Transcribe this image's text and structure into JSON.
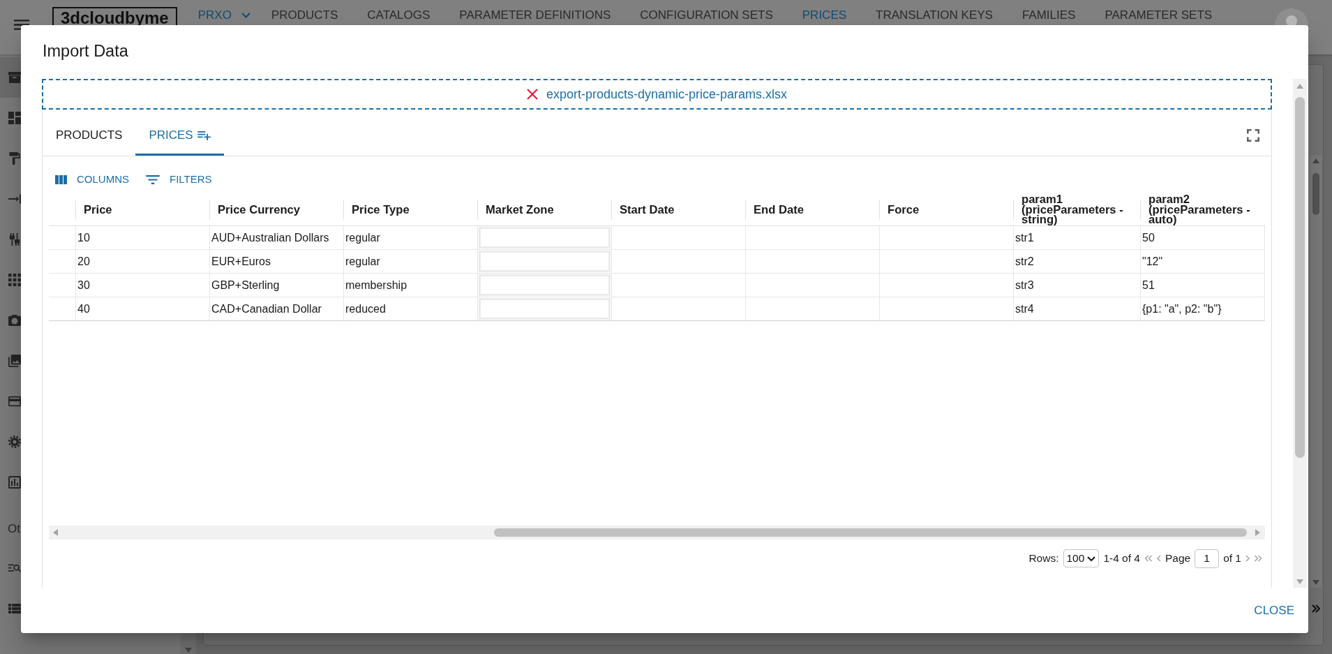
{
  "app": {
    "logo": "3dcloudbyme",
    "workspace": "PRXO",
    "nav": [
      {
        "label": "PRODUCTS",
        "selected": false
      },
      {
        "label": "CATALOGS",
        "selected": false
      },
      {
        "label": "PARAMETER DEFINITIONS",
        "selected": false
      },
      {
        "label": "CONFIGURATION SETS",
        "selected": false
      },
      {
        "label": "PRICES",
        "selected": true
      },
      {
        "label": "TRANSLATION KEYS",
        "selected": false
      },
      {
        "label": "FAMILIES",
        "selected": false
      },
      {
        "label": "PARAMETER SETS",
        "selected": false
      }
    ]
  },
  "sidebar": {
    "items": [
      {
        "selected": true
      },
      {
        "selected": false
      },
      {
        "selected": false
      },
      {
        "selected": false
      },
      {
        "selected": false
      },
      {
        "selected": false
      },
      {
        "selected": false
      },
      {
        "selected": false
      },
      {
        "selected": false
      },
      {
        "selected": false
      },
      {
        "selected": false
      }
    ],
    "sections": [
      {
        "title": "Ot",
        "items": [
          {
            "selected": false
          },
          {
            "selected": false
          }
        ]
      }
    ]
  },
  "dialog": {
    "title": "Import Data",
    "file": {
      "name": "export-products-dynamic-price-params.xlsx"
    },
    "tabs": [
      {
        "label": "PRODUCTS",
        "selected": false,
        "has_icon": false
      },
      {
        "label": "PRICES",
        "selected": true,
        "has_icon": true
      }
    ],
    "toolbar": [
      {
        "kind": "columns",
        "label": "COLUMNS"
      },
      {
        "kind": "filters",
        "label": "FILTERS"
      }
    ],
    "table": {
      "columns": [
        "Price",
        "Price Currency",
        "Price Type",
        "Market Zone",
        "Start Date",
        "End Date",
        "Force",
        "param1 (priceParameters - string)",
        "param2 (priceParameters - auto)"
      ],
      "rows": [
        {
          "cells": [
            {
              "kind": "text",
              "text": "10"
            },
            {
              "kind": "text",
              "text": "AUD+Australian Dollars"
            },
            {
              "kind": "text",
              "text": "regular"
            },
            {
              "kind": "field"
            },
            {
              "kind": "blank"
            },
            {
              "kind": "blank"
            },
            {
              "kind": "blank"
            },
            {
              "kind": "text",
              "text": "str1"
            },
            {
              "kind": "text",
              "text": "50"
            }
          ]
        },
        {
          "cells": [
            {
              "kind": "text",
              "text": "20"
            },
            {
              "kind": "text",
              "text": "EUR+Euros"
            },
            {
              "kind": "text",
              "text": "regular"
            },
            {
              "kind": "field"
            },
            {
              "kind": "blank"
            },
            {
              "kind": "blank"
            },
            {
              "kind": "blank"
            },
            {
              "kind": "text",
              "text": "str2"
            },
            {
              "kind": "text",
              "text": "\"12\""
            }
          ]
        },
        {
          "cells": [
            {
              "kind": "text",
              "text": "30"
            },
            {
              "kind": "text",
              "text": "GBP+Sterling"
            },
            {
              "kind": "text",
              "text": "membership"
            },
            {
              "kind": "field"
            },
            {
              "kind": "blank"
            },
            {
              "kind": "blank"
            },
            {
              "kind": "blank"
            },
            {
              "kind": "text",
              "text": "str3"
            },
            {
              "kind": "text",
              "text": "51"
            }
          ]
        },
        {
          "cells": [
            {
              "kind": "text",
              "text": "40"
            },
            {
              "kind": "text",
              "text": "CAD+Canadian Dollar"
            },
            {
              "kind": "text",
              "text": "reduced"
            },
            {
              "kind": "field"
            },
            {
              "kind": "blank"
            },
            {
              "kind": "blank"
            },
            {
              "kind": "blank"
            },
            {
              "kind": "text",
              "text": "str4"
            },
            {
              "kind": "text",
              "text": "{p1: \"a\", p2: \"b\"}"
            }
          ]
        }
      ]
    },
    "pagination": {
      "rows_label": "Rows:",
      "page_size": "100",
      "range": "1-4 of 4",
      "page_label": "Page",
      "page": "1",
      "page_total": "of 1",
      "controls": [
        {
          "kind": "first",
          "disabled": true
        },
        {
          "kind": "previous",
          "disabled": true
        },
        {
          "kind": "next",
          "disabled": true
        },
        {
          "kind": "last",
          "disabled": true
        }
      ]
    },
    "buttons": [
      "CLOSE"
    ]
  }
}
